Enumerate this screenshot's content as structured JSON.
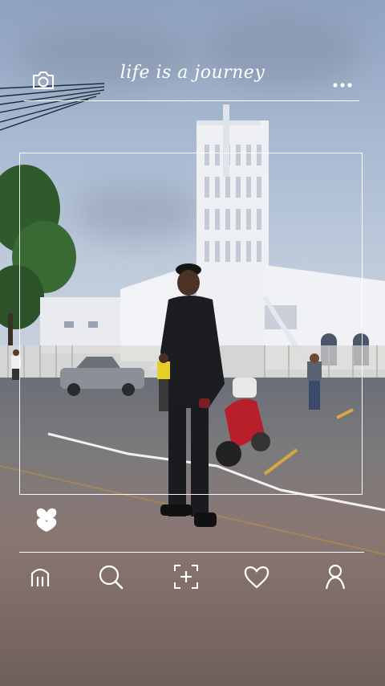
{
  "header": {
    "title": "life is a journey",
    "camera_icon": "camera-icon",
    "menu_icon": "more-dots-icon"
  },
  "photo": {
    "description_icon": "like-heart-icon"
  },
  "bottom_nav": {
    "items": [
      {
        "icon": "home-icon"
      },
      {
        "icon": "search-icon"
      },
      {
        "icon": "add-icon"
      },
      {
        "icon": "heart-icon"
      },
      {
        "icon": "profile-icon"
      }
    ]
  },
  "colors": {
    "frame": "#ffffff",
    "accent": "#ffffff"
  }
}
